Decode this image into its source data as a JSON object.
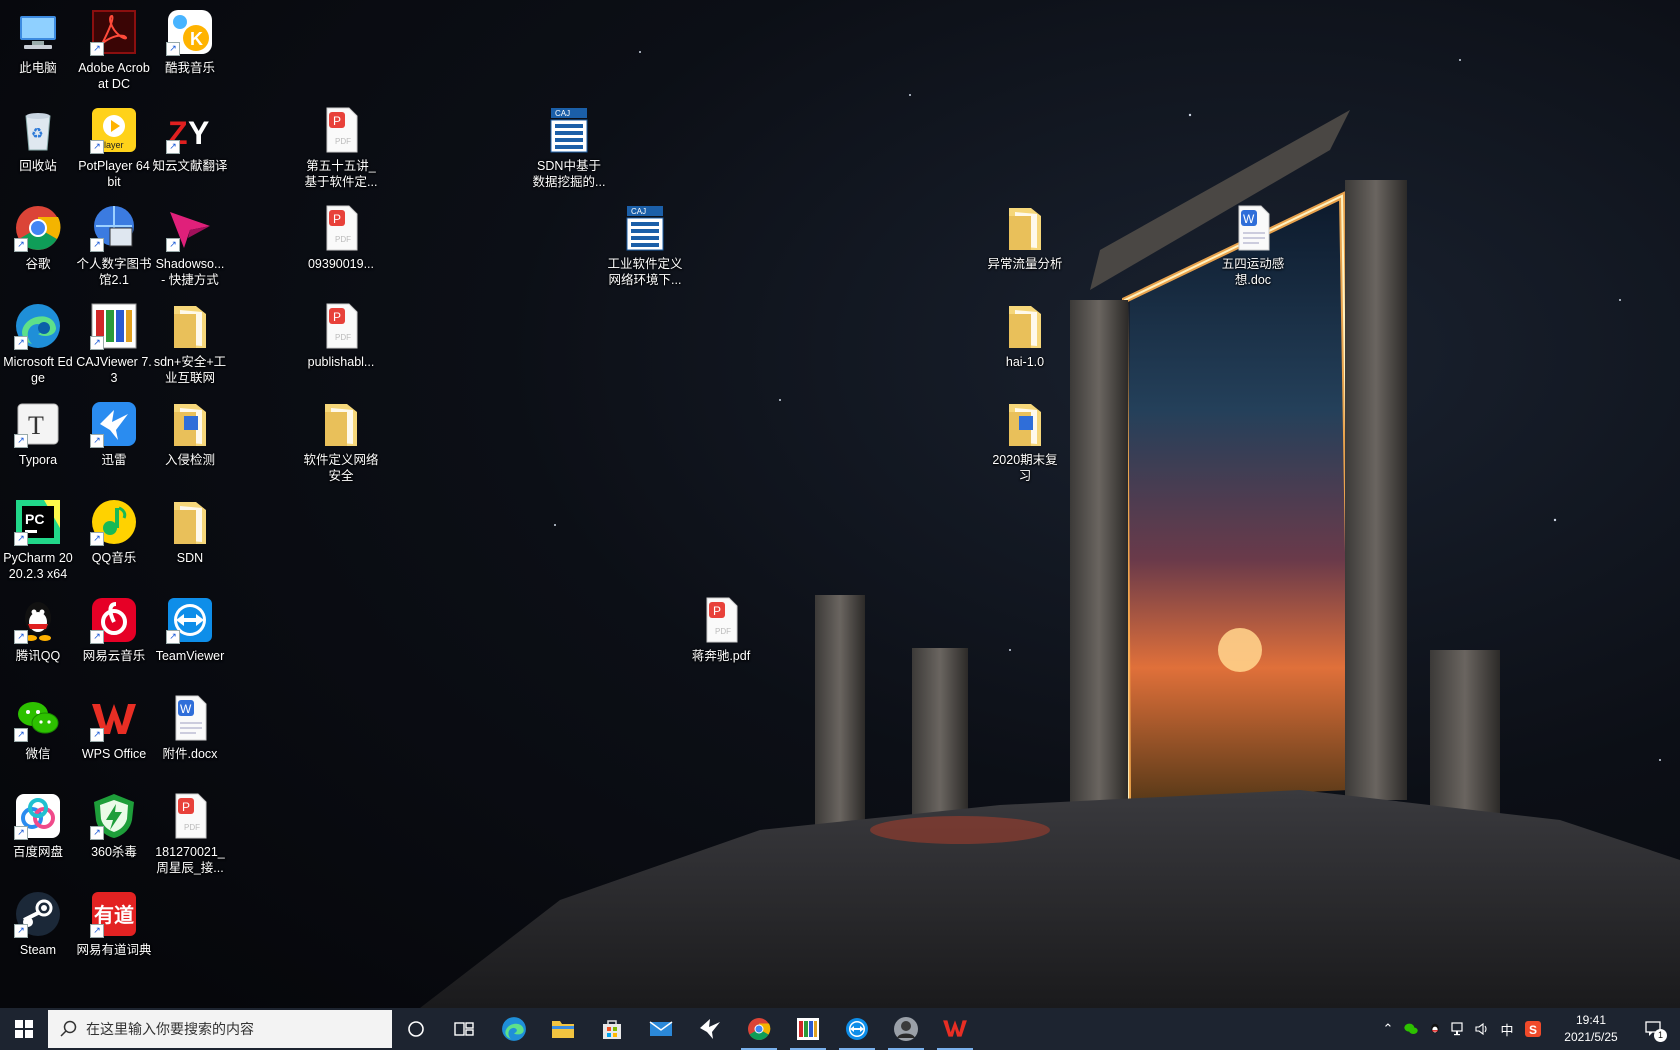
{
  "desktop": {
    "icons": [
      {
        "label": "此电脑",
        "icon": "computer-icon"
      },
      {
        "label": "Adobe Acrobat DC",
        "icon": "acrobat-icon"
      },
      {
        "label": "酷我音乐",
        "icon": "kuwo-music-icon"
      },
      {
        "label": "回收站",
        "icon": "recycle-bin-icon"
      },
      {
        "label": "PotPlayer 64 bit",
        "icon": "potplayer-icon"
      },
      {
        "label": "知云文献翻译",
        "icon": "zhiyun-icon"
      },
      {
        "label": "第五十五讲_基于软件定...",
        "icon": "pdf-file-icon"
      },
      {
        "label": "SDN中基于数据挖掘的...",
        "icon": "caj-file-icon"
      },
      {
        "label": "谷歌",
        "icon": "chrome-icon"
      },
      {
        "label": "个人数字图书馆2.1",
        "icon": "digital-library-icon"
      },
      {
        "label": "Shadowso... - 快捷方式",
        "icon": "shadowsocks-icon"
      },
      {
        "label": "09390019...",
        "icon": "pdf-file-icon"
      },
      {
        "label": "工业软件定义网络环境下...",
        "icon": "caj-file-icon"
      },
      {
        "label": "异常流量分析",
        "icon": "folder-icon"
      },
      {
        "label": "五四运动感想.doc",
        "icon": "word-doc-icon"
      },
      {
        "label": "Microsoft Edge",
        "icon": "edge-icon"
      },
      {
        "label": "CAJViewer 7.3",
        "icon": "cajviewer-icon"
      },
      {
        "label": "sdn+安全+工业互联网",
        "icon": "folder-icon"
      },
      {
        "label": "publishabl...",
        "icon": "pdf-file-icon"
      },
      {
        "label": "hai-1.0",
        "icon": "folder-icon"
      },
      {
        "label": "Typora",
        "icon": "typora-icon"
      },
      {
        "label": "迅雷",
        "icon": "xunlei-icon"
      },
      {
        "label": "入侵检测",
        "icon": "folder-icon"
      },
      {
        "label": "软件定义网络安全",
        "icon": "folder-icon"
      },
      {
        "label": "2020期末复习",
        "icon": "folder-icon"
      },
      {
        "label": "PyCharm 2020.2.3 x64",
        "icon": "pycharm-icon"
      },
      {
        "label": "QQ音乐",
        "icon": "qq-music-icon"
      },
      {
        "label": "SDN",
        "icon": "folder-icon"
      },
      {
        "label": "蒋奔驰.pdf",
        "icon": "pdf-file-icon"
      },
      {
        "label": "腾讯QQ",
        "icon": "qq-icon"
      },
      {
        "label": "网易云音乐",
        "icon": "netease-music-icon"
      },
      {
        "label": "TeamViewer",
        "icon": "teamviewer-icon"
      },
      {
        "label": "微信",
        "icon": "wechat-icon"
      },
      {
        "label": "WPS Office",
        "icon": "wps-icon"
      },
      {
        "label": "附件.docx",
        "icon": "word-doc-icon"
      },
      {
        "label": "百度网盘",
        "icon": "baidu-netdisk-icon"
      },
      {
        "label": "360杀毒",
        "icon": "antivirus-360-icon"
      },
      {
        "label": "181270021_周星辰_接...",
        "icon": "pdf-file-icon"
      },
      {
        "label": "Steam",
        "icon": "steam-icon"
      },
      {
        "label": "网易有道词典",
        "icon": "youdao-icon"
      }
    ]
  },
  "taskbar": {
    "search_placeholder": "在这里输入你要搜索的内容",
    "apps": [
      {
        "name": "cortana-icon"
      },
      {
        "name": "task-view-icon"
      },
      {
        "name": "edge-icon"
      },
      {
        "name": "file-explorer-icon"
      },
      {
        "name": "store-icon"
      },
      {
        "name": "mail-icon"
      },
      {
        "name": "xunlei-icon"
      },
      {
        "name": "chrome-icon"
      },
      {
        "name": "cajviewer-icon"
      },
      {
        "name": "teamviewer-icon"
      },
      {
        "name": "user-photo-icon"
      },
      {
        "name": "wps-icon"
      }
    ],
    "tray": {
      "ime": "中",
      "time": "19:41",
      "date": "2021/5/25",
      "notifications": "1"
    }
  }
}
